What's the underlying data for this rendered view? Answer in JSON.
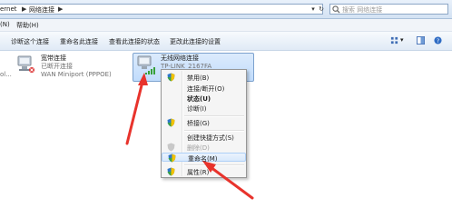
{
  "address_bar": {
    "crumb_1": "ernet",
    "crumb_2": "网络连接",
    "search_placeholder": "搜索 网络连接"
  },
  "menu_bar": {
    "items": [
      "(N)",
      "帮助(H)"
    ]
  },
  "toolbar": {
    "items": [
      "诊断这个连接",
      "重命名此连接",
      "查看此连接的状态",
      "更改此连接的设置"
    ]
  },
  "connections": [
    {
      "name": "宽带连接",
      "status": "已断开连接",
      "device": "WAN Miniport (PPPOE)",
      "left_fragment": "ol..."
    },
    {
      "name": "无线网络连接",
      "status": "TP-LINK_2167FA"
    }
  ],
  "context_menu": {
    "items": [
      {
        "label": "禁用(B)",
        "bold": false,
        "disabled": false,
        "shield": true
      },
      {
        "label": "连接/断开(O)",
        "bold": false,
        "disabled": false,
        "shield": false
      },
      {
        "label": "状态(U)",
        "bold": true,
        "disabled": false,
        "shield": false
      },
      {
        "label": "诊断(I)",
        "bold": false,
        "disabled": false,
        "shield": false
      },
      {
        "label": "桥接(G)",
        "bold": false,
        "disabled": false,
        "shield": true
      },
      {
        "label": "创建快捷方式(S)",
        "bold": false,
        "disabled": false,
        "shield": false
      },
      {
        "label": "删除(D)",
        "bold": false,
        "disabled": true,
        "shield": true
      },
      {
        "label": "重命名(M)",
        "bold": false,
        "disabled": false,
        "shield": true
      },
      {
        "label": "属性(R)",
        "bold": false,
        "disabled": false,
        "shield": true
      }
    ]
  },
  "colors": {
    "annotation_arrow": "#e8332c",
    "selection": "#c1dcfc",
    "window_bg": "#ffffff"
  }
}
